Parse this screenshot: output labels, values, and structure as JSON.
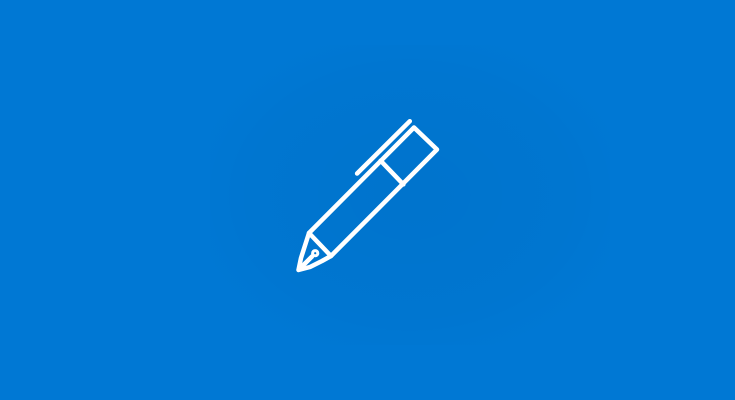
{
  "splash": {
    "background_color": "#0078D4",
    "icon_color": "#FFFFFF",
    "icon": "fountain-pen-icon"
  }
}
